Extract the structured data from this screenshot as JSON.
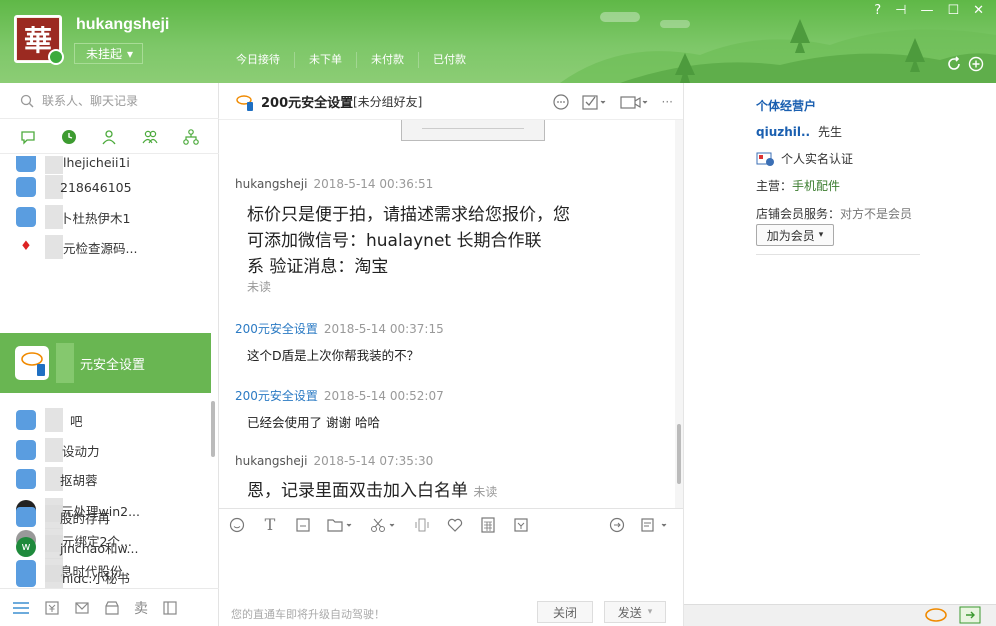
{
  "header": {
    "avatar_char": "華",
    "username": "hukangsheji",
    "status": "未挂起",
    "tabs": [
      "今日接待",
      "未下单",
      "未付款",
      "已付款"
    ],
    "win_controls": [
      "?",
      "⊣",
      "—",
      "☐",
      "✕"
    ]
  },
  "sidebar": {
    "search_placeholder": "联系人、聊天记录",
    "contacts": [
      {
        "name": "lhejicheii1i"
      },
      {
        "name": "218646105"
      },
      {
        "name": "卜杜热伊木1"
      },
      {
        "name": "元检查源码..."
      },
      {
        "name": "元安全设置"
      },
      {
        "name": "吧"
      },
      {
        "name": "设动力"
      },
      {
        "name": "抠胡蓉"
      },
      {
        "name": "元处理win2..."
      },
      {
        "name": "元绑定2个..."
      },
      {
        "name": "息时代股份"
      },
      {
        "name": "股的存再"
      },
      {
        "name": "jinchao和w..."
      },
      {
        "name": "nidc:小秘书"
      }
    ]
  },
  "chat": {
    "title": "200元安全设置",
    "group": "[未分组好友]",
    "messages": [
      {
        "sender": "hukangsheji",
        "time": "2018-5-14 00:36:51",
        "lines": [
          "标价只是便于拍，请描述需求给您报价，您",
          "可添加微信号：hualaynet 长期合作联",
          "系 验证消息：淘宝"
        ],
        "status": "未读"
      },
      {
        "sender": "200元安全设置",
        "time": "2018-5-14 00:37:15",
        "lines": [
          "这个D盾是上次你帮我装的不？"
        ],
        "status": ""
      },
      {
        "sender": "200元安全设置",
        "time": "2018-5-14 00:52:07",
        "lines": [
          "已经会使用了 谢谢 哈哈"
        ],
        "status": ""
      },
      {
        "sender": "hukangsheji",
        "time": "2018-5-14 07:35:30",
        "lines": [
          "恩，记录里面双击加入白名单"
        ],
        "status": "未读"
      }
    ],
    "notice": "您的直通车即将升级自动驾驶！",
    "close_label": "关闭",
    "send_label": "发送"
  },
  "profile": {
    "type": "个体经营户",
    "name": "qiuzhil..",
    "gender": "先生",
    "verify": "个人实名认证",
    "main_cat_label": "主营：",
    "main_cat": "手机配件",
    "member_label": "店铺会员服务：",
    "member_value": "对方不是会员",
    "join_button": "加为会员"
  },
  "colors": {
    "header_green": "#69b652",
    "buyer_blue": "#2c7bc4",
    "link_blue": "#1a5fb0",
    "seller_green": "#3c7d30"
  }
}
